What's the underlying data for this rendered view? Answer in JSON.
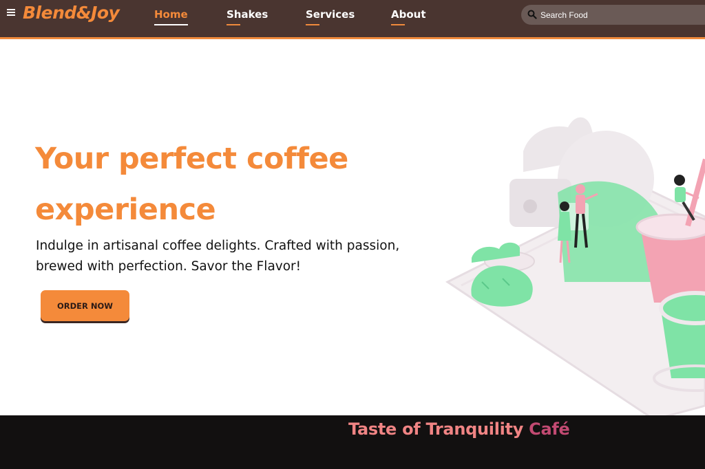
{
  "nav": {
    "brand": "Blend&Joy",
    "links": [
      {
        "label": "Home",
        "active": true
      },
      {
        "label": "Shakes",
        "active": false
      },
      {
        "label": "Services",
        "active": false
      },
      {
        "label": "About",
        "active": false
      }
    ],
    "search": {
      "placeholder": "Search Food",
      "value": ""
    },
    "icons": {
      "menu": "hamburger-menu-icon",
      "search": "search-icon"
    }
  },
  "hero": {
    "title": "Your perfect coffee experience",
    "subtitle": "Indulge in artisanal coffee delights. Crafted with passion, brewed with perfection. Savor the Flavor!",
    "cta_label": "ORDER NOW"
  },
  "band": {
    "title_main": "Taste of Tranquility ",
    "title_accent": "Café"
  },
  "colors": {
    "accent": "#f48a3a",
    "nav_bg": "#4a3530",
    "band_bg": "#121010",
    "band_title": "#f08484",
    "band_accent": "#c24a72",
    "illustration_green": "#7fe3a6",
    "illustration_pink": "#f3a3b3"
  }
}
